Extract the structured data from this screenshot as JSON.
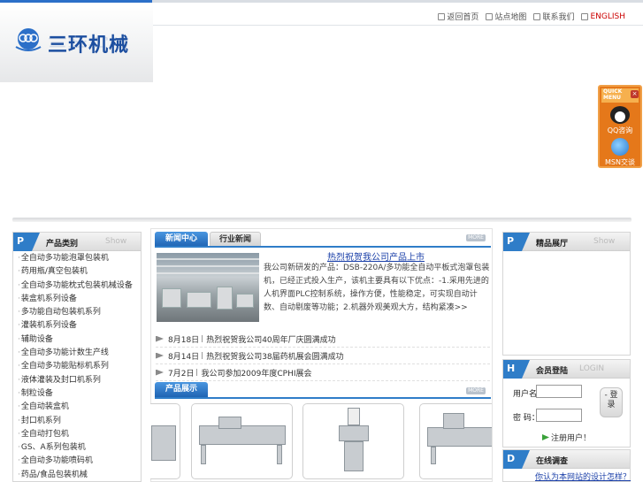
{
  "header": {
    "links": [
      {
        "label": "返回首页",
        "icon": "home-icon"
      },
      {
        "label": "站点地图",
        "icon": "sitemap-icon"
      },
      {
        "label": "联系我们",
        "icon": "contact-icon"
      },
      {
        "label": "ENGLISH",
        "icon": "english-icon"
      }
    ],
    "logo_text": "三环机械"
  },
  "quick_menu": {
    "head": "QUICK MENU",
    "close": "×",
    "qq_label": "QQ咨询",
    "msn_label": "MSN交谈"
  },
  "categories": {
    "badge": "P",
    "title": "产品类别",
    "show": "Show",
    "items": [
      "全自动多功能泡罩包装机",
      "药用瓶/真空包装机",
      "全自动多功能枕式包装机械设备",
      "装盒机系列设备",
      "多功能自动包装机系列",
      "灌装机系列设备",
      "辅助设备",
      "全自动多功能计数生产线",
      "全自动多功能贴标机系列",
      "液体灌装及封口机系列",
      "制粒设备",
      "全自动装盒机",
      "封口机系列",
      "全自动打包机",
      "GS、A系列包装机",
      "全自动多功能喷码机",
      "药品/食品包装机械"
    ]
  },
  "news": {
    "tab_active": "新闻中心",
    "tab_inactive": "行业新闻",
    "more": "MORE",
    "headline": "热烈祝贺我公司产品上市",
    "summary": "我公司新研发的产品：DSB-220A/多功能全自动平板式泡罩包装机，已经正式投入生产，该机主要具有以下优点：-1.采用先进的人机界面PLC控制系统，操作方便，性能稳定，可实现自动计数、自动剔废等功能；2.机器外观美观大方，结构紧凑>>",
    "items": [
      {
        "date": "8月18日",
        "title": "热烈祝贺我公司40周年厂庆圆满成功"
      },
      {
        "date": "8月14日",
        "title": "热烈祝贺我公司38届药机展会圆满成功"
      },
      {
        "date": "7月2日",
        "title": "我公司参加2009年度CPHI展会"
      }
    ]
  },
  "products": {
    "title": "产品展示",
    "more": "MORE"
  },
  "showcase": {
    "badge": "P",
    "title": "精品展厅",
    "show": "Show"
  },
  "member": {
    "badge": "H",
    "title": "会员登陆",
    "sub": "LOGIN",
    "user_label": "用户名：",
    "pass_label": "密  码：",
    "login_button": "- 登录",
    "register": "注册用户！"
  },
  "survey": {
    "badge": "D",
    "title": "在线调查",
    "link": "你认为本网站的设计怎样？"
  }
}
